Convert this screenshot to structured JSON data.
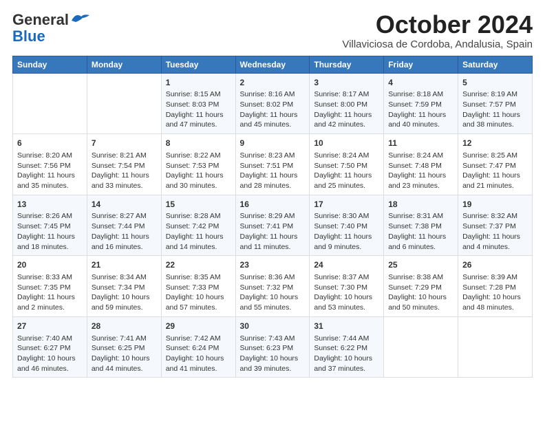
{
  "header": {
    "logo_line1": "General",
    "logo_line2": "Blue",
    "title": "October 2024",
    "subtitle": "Villaviciosa de Cordoba, Andalusia, Spain"
  },
  "columns": [
    "Sunday",
    "Monday",
    "Tuesday",
    "Wednesday",
    "Thursday",
    "Friday",
    "Saturday"
  ],
  "weeks": [
    [
      {
        "day": "",
        "info": ""
      },
      {
        "day": "",
        "info": ""
      },
      {
        "day": "1",
        "info": "Sunrise: 8:15 AM\nSunset: 8:03 PM\nDaylight: 11 hours and 47 minutes."
      },
      {
        "day": "2",
        "info": "Sunrise: 8:16 AM\nSunset: 8:02 PM\nDaylight: 11 hours and 45 minutes."
      },
      {
        "day": "3",
        "info": "Sunrise: 8:17 AM\nSunset: 8:00 PM\nDaylight: 11 hours and 42 minutes."
      },
      {
        "day": "4",
        "info": "Sunrise: 8:18 AM\nSunset: 7:59 PM\nDaylight: 11 hours and 40 minutes."
      },
      {
        "day": "5",
        "info": "Sunrise: 8:19 AM\nSunset: 7:57 PM\nDaylight: 11 hours and 38 minutes."
      }
    ],
    [
      {
        "day": "6",
        "info": "Sunrise: 8:20 AM\nSunset: 7:56 PM\nDaylight: 11 hours and 35 minutes."
      },
      {
        "day": "7",
        "info": "Sunrise: 8:21 AM\nSunset: 7:54 PM\nDaylight: 11 hours and 33 minutes."
      },
      {
        "day": "8",
        "info": "Sunrise: 8:22 AM\nSunset: 7:53 PM\nDaylight: 11 hours and 30 minutes."
      },
      {
        "day": "9",
        "info": "Sunrise: 8:23 AM\nSunset: 7:51 PM\nDaylight: 11 hours and 28 minutes."
      },
      {
        "day": "10",
        "info": "Sunrise: 8:24 AM\nSunset: 7:50 PM\nDaylight: 11 hours and 25 minutes."
      },
      {
        "day": "11",
        "info": "Sunrise: 8:24 AM\nSunset: 7:48 PM\nDaylight: 11 hours and 23 minutes."
      },
      {
        "day": "12",
        "info": "Sunrise: 8:25 AM\nSunset: 7:47 PM\nDaylight: 11 hours and 21 minutes."
      }
    ],
    [
      {
        "day": "13",
        "info": "Sunrise: 8:26 AM\nSunset: 7:45 PM\nDaylight: 11 hours and 18 minutes."
      },
      {
        "day": "14",
        "info": "Sunrise: 8:27 AM\nSunset: 7:44 PM\nDaylight: 11 hours and 16 minutes."
      },
      {
        "day": "15",
        "info": "Sunrise: 8:28 AM\nSunset: 7:42 PM\nDaylight: 11 hours and 14 minutes."
      },
      {
        "day": "16",
        "info": "Sunrise: 8:29 AM\nSunset: 7:41 PM\nDaylight: 11 hours and 11 minutes."
      },
      {
        "day": "17",
        "info": "Sunrise: 8:30 AM\nSunset: 7:40 PM\nDaylight: 11 hours and 9 minutes."
      },
      {
        "day": "18",
        "info": "Sunrise: 8:31 AM\nSunset: 7:38 PM\nDaylight: 11 hours and 6 minutes."
      },
      {
        "day": "19",
        "info": "Sunrise: 8:32 AM\nSunset: 7:37 PM\nDaylight: 11 hours and 4 minutes."
      }
    ],
    [
      {
        "day": "20",
        "info": "Sunrise: 8:33 AM\nSunset: 7:35 PM\nDaylight: 11 hours and 2 minutes."
      },
      {
        "day": "21",
        "info": "Sunrise: 8:34 AM\nSunset: 7:34 PM\nDaylight: 10 hours and 59 minutes."
      },
      {
        "day": "22",
        "info": "Sunrise: 8:35 AM\nSunset: 7:33 PM\nDaylight: 10 hours and 57 minutes."
      },
      {
        "day": "23",
        "info": "Sunrise: 8:36 AM\nSunset: 7:32 PM\nDaylight: 10 hours and 55 minutes."
      },
      {
        "day": "24",
        "info": "Sunrise: 8:37 AM\nSunset: 7:30 PM\nDaylight: 10 hours and 53 minutes."
      },
      {
        "day": "25",
        "info": "Sunrise: 8:38 AM\nSunset: 7:29 PM\nDaylight: 10 hours and 50 minutes."
      },
      {
        "day": "26",
        "info": "Sunrise: 8:39 AM\nSunset: 7:28 PM\nDaylight: 10 hours and 48 minutes."
      }
    ],
    [
      {
        "day": "27",
        "info": "Sunrise: 7:40 AM\nSunset: 6:27 PM\nDaylight: 10 hours and 46 minutes."
      },
      {
        "day": "28",
        "info": "Sunrise: 7:41 AM\nSunset: 6:25 PM\nDaylight: 10 hours and 44 minutes."
      },
      {
        "day": "29",
        "info": "Sunrise: 7:42 AM\nSunset: 6:24 PM\nDaylight: 10 hours and 41 minutes."
      },
      {
        "day": "30",
        "info": "Sunrise: 7:43 AM\nSunset: 6:23 PM\nDaylight: 10 hours and 39 minutes."
      },
      {
        "day": "31",
        "info": "Sunrise: 7:44 AM\nSunset: 6:22 PM\nDaylight: 10 hours and 37 minutes."
      },
      {
        "day": "",
        "info": ""
      },
      {
        "day": "",
        "info": ""
      }
    ]
  ]
}
